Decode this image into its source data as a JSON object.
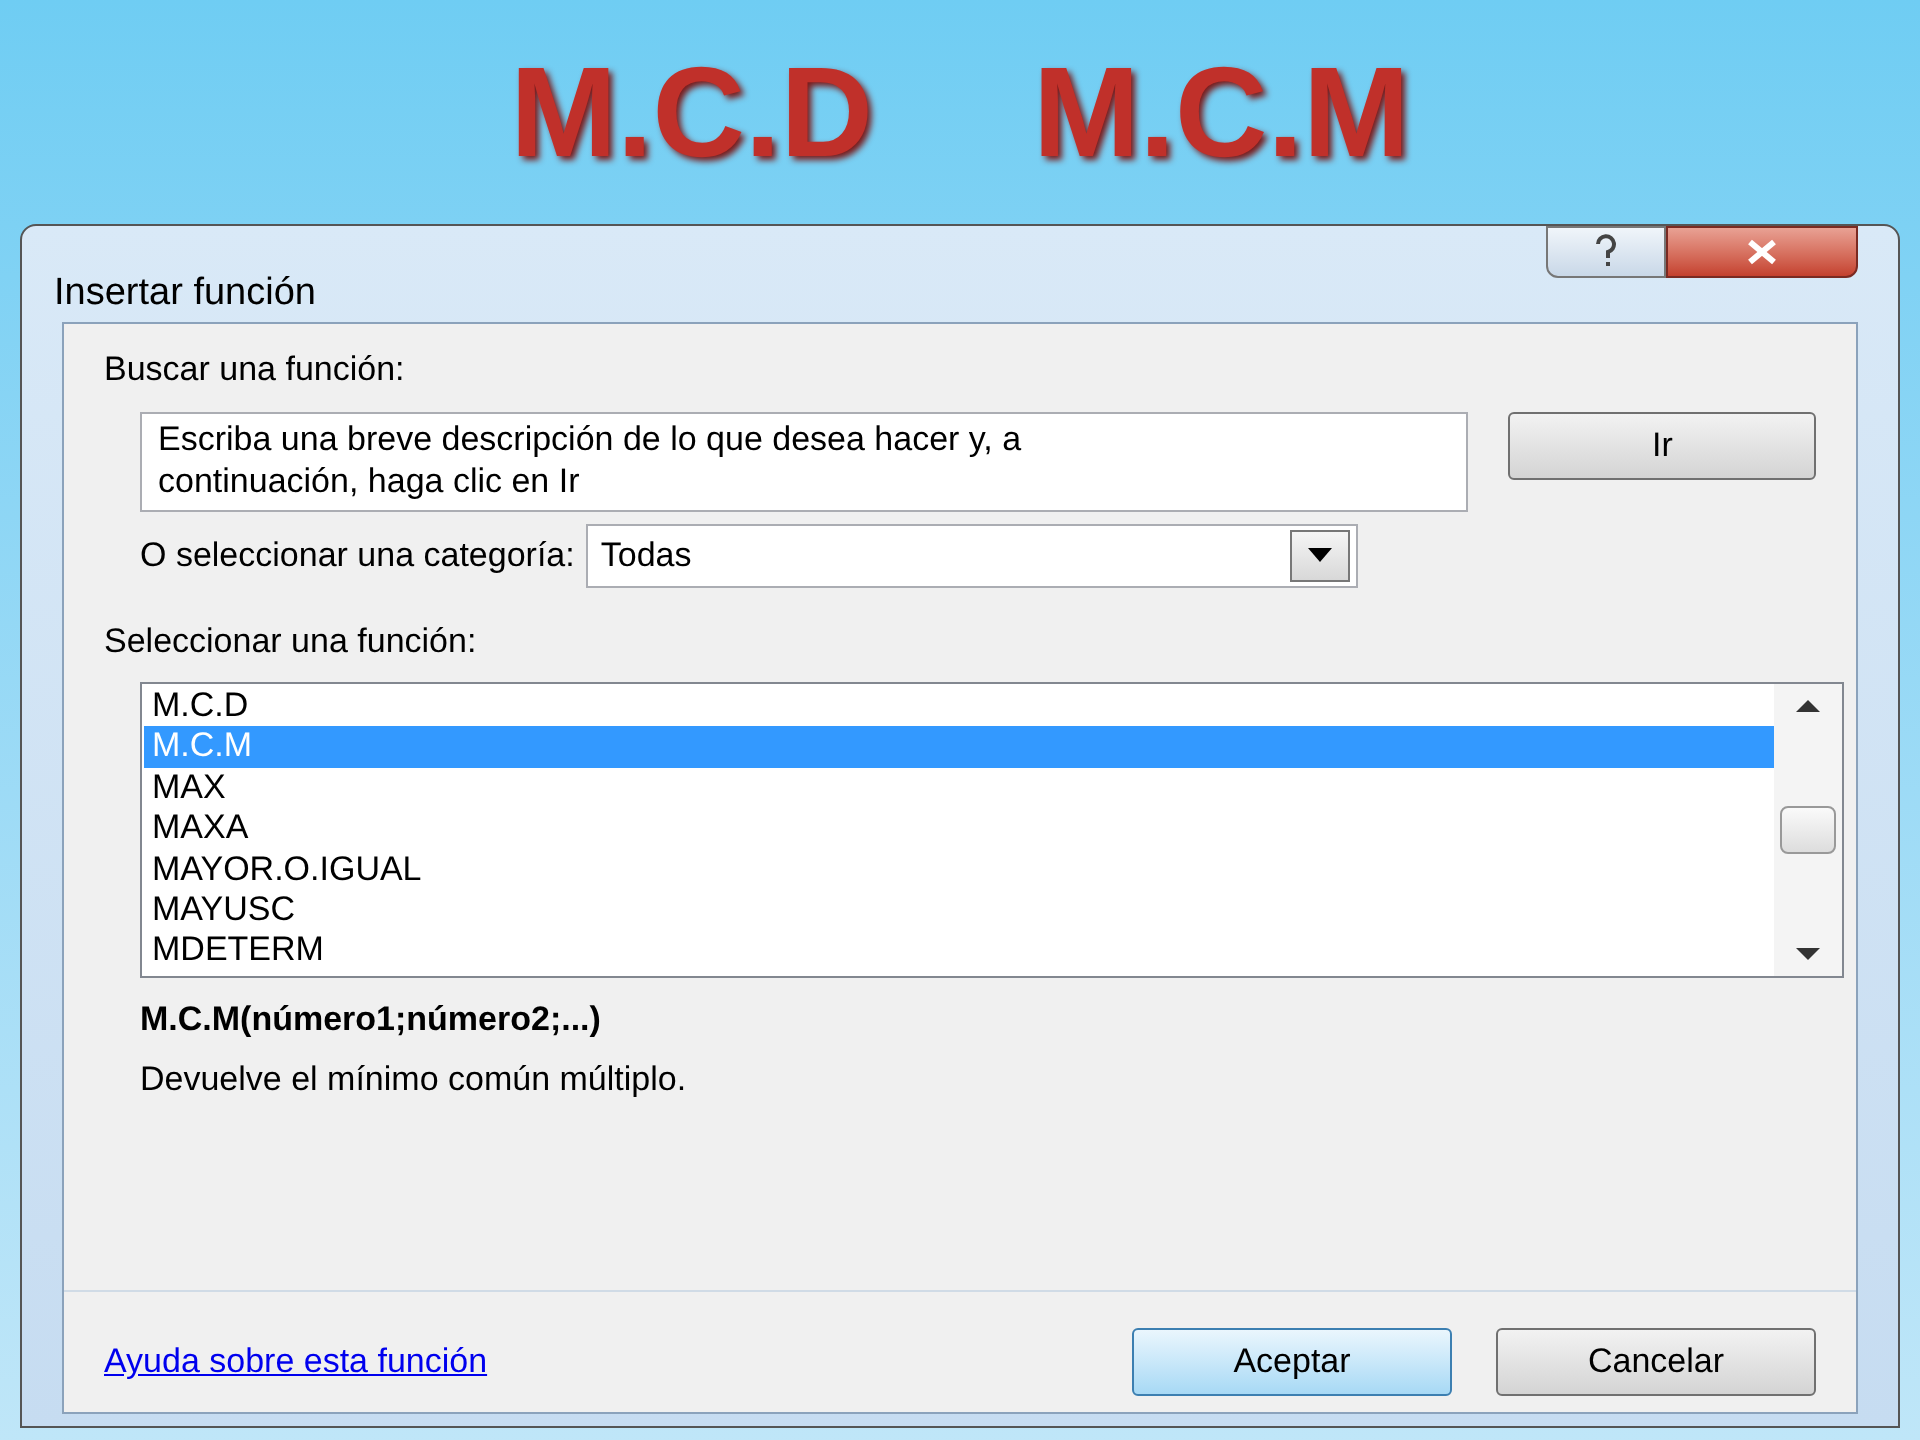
{
  "slide_title": [
    "M.C.D",
    "M.C.M"
  ],
  "window": {
    "title": "Insertar función"
  },
  "search": {
    "label": "Buscar una función:",
    "placeholder": "Escriba una breve descripción de lo que desea hacer y, a continuación, haga clic en Ir",
    "button": "Ir"
  },
  "category": {
    "label": "O seleccionar una categoría:",
    "value": "Todas"
  },
  "functions": {
    "label": "Seleccionar una función:",
    "items": [
      {
        "name": "M.C.D",
        "selected": false
      },
      {
        "name": "M.C.M",
        "selected": true
      },
      {
        "name": "MAX",
        "selected": false
      },
      {
        "name": "MAXA",
        "selected": false
      },
      {
        "name": "MAYOR.O.IGUAL",
        "selected": false
      },
      {
        "name": "MAYUSC",
        "selected": false
      },
      {
        "name": "MDETERM",
        "selected": false
      }
    ]
  },
  "syntax": "M.C.M(número1;número2;...)",
  "description": "Devuelve el mínimo común múltiplo.",
  "help_link": "Ayuda sobre esta función",
  "buttons": [
    {
      "label": "Aceptar",
      "default": true
    },
    {
      "label": "Cancelar",
      "default": false
    }
  ]
}
